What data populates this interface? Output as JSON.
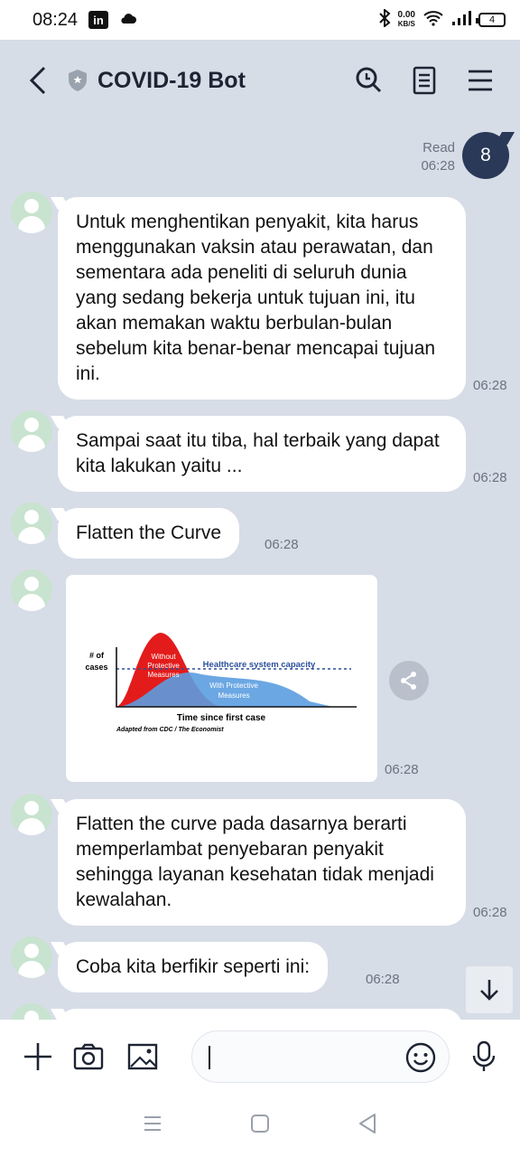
{
  "status_bar": {
    "time": "08:24",
    "net_speed_value": "0.00",
    "net_speed_unit": "KB/S",
    "battery": "4"
  },
  "header": {
    "title": "COVID-19 Bot"
  },
  "read_receipt": {
    "label": "Read",
    "time": "06:28"
  },
  "my_message": {
    "text": "8"
  },
  "messages": [
    {
      "text": "Untuk menghentikan penyakit, kita harus menggunakan vaksin atau perawatan, dan sementara ada peneliti di seluruh dunia yang sedang bekerja untuk tujuan ini, itu akan memakan waktu berbulan-bulan sebelum kita benar-benar mencapai tujuan ini.",
      "time": "06:28"
    },
    {
      "text": "Sampai saat itu tiba, hal terbaik yang dapat kita lakukan yaitu ...",
      "time": "06:28"
    },
    {
      "text": "Flatten the Curve",
      "time": "06:28"
    },
    {
      "text": "Flatten the curve pada dasarnya berarti memperlambat penyebaran penyakit sehingga layanan kesehatan tidak menjadi kewalahan.",
      "time": "06:28"
    },
    {
      "text": "Coba kita berfikir seperti ini:",
      "time": "06:28"
    }
  ],
  "image_message": {
    "time": "06:28",
    "chart": {
      "y_label_line1": "# of",
      "y_label_line2": "cases",
      "without_line1": "Without",
      "without_line2": "Protective",
      "without_line3": "Measures",
      "capacity_label": "Healthcare system capacity",
      "with_line1": "With Protective",
      "with_line2": "Measures",
      "x_label": "Time since first case",
      "source": "Adapted from CDC / The Economist"
    }
  },
  "colors": {
    "chat_bg": "#d7dde7",
    "my_bubble": "#2a3958",
    "red_curve": "#e31b1b",
    "blue_curve": "#5b9de0"
  }
}
